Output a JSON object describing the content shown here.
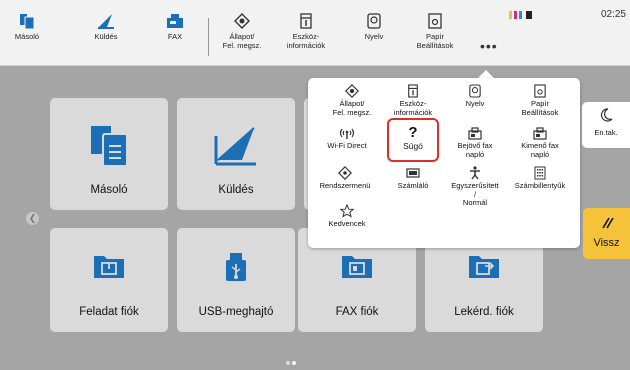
{
  "topbar": {
    "items": [
      {
        "label": "Másoló",
        "icon": "copy-icon"
      },
      {
        "label": "Küldés",
        "icon": "send-icon"
      },
      {
        "label": "FAX",
        "icon": "fax-icon"
      },
      {
        "label": "Állapot/\nFel. megsz.",
        "icon": "status-icon"
      },
      {
        "label": "Eszköz-\ninformációk",
        "icon": "device-info-icon"
      },
      {
        "label": "Nyelv",
        "icon": "language-icon"
      },
      {
        "label": "Papír\nBeállítások",
        "icon": "paper-settings-icon"
      }
    ],
    "more": "•••",
    "clock": "02:25",
    "toner_colors": [
      "#e6c62a",
      "#d02a8e",
      "#2a8fd0",
      "#222222"
    ]
  },
  "tiles": [
    {
      "label": "Másoló",
      "icon": "copy-icon"
    },
    {
      "label": "Küldés",
      "icon": "send-icon"
    },
    {
      "label": "Feladat fiók",
      "icon": "job-box-icon"
    },
    {
      "label": "USB-meghajtó",
      "icon": "usb-icon"
    },
    {
      "label": "FAX fiók",
      "icon": "fax-box-icon"
    },
    {
      "label": "Lekérd. fiók",
      "icon": "polling-box-icon"
    }
  ],
  "popup": {
    "items": [
      {
        "label": "Állapot/\nFel. megsz.",
        "icon": "status-icon"
      },
      {
        "label": "Eszköz-\ninformációk",
        "icon": "device-info-icon"
      },
      {
        "label": "Nyelv",
        "icon": "language-icon"
      },
      {
        "label": "Papír\nBeállítások",
        "icon": "paper-settings-icon"
      },
      {
        "label": "Wi-Fi Direct",
        "icon": "wifi-direct-icon"
      },
      {
        "label": "Súgó",
        "icon": "help-icon"
      },
      {
        "label": "Bejövő fax\nnapló",
        "icon": "incoming-fax-log-icon"
      },
      {
        "label": "Kimenő fax\nnapló",
        "icon": "outgoing-fax-log-icon"
      },
      {
        "label": "Rendszermenü",
        "icon": "system-menu-icon"
      },
      {
        "label": "Számláló",
        "icon": "counter-icon"
      },
      {
        "label": "Egyszerűsített\n/\nNormál",
        "icon": "accessibility-icon"
      },
      {
        "label": "Számbillentyűk",
        "icon": "numeric-keypad-icon"
      },
      {
        "label": "Kedvencek",
        "icon": "favorites-icon"
      }
    ]
  },
  "side": {
    "sleep_label": "En.tak.",
    "back_label": "Vissz"
  },
  "colors": {
    "accent_yellow": "#f5c33a",
    "highlight_red": "#d9302b",
    "tile_blue": "#1a6fb6"
  }
}
